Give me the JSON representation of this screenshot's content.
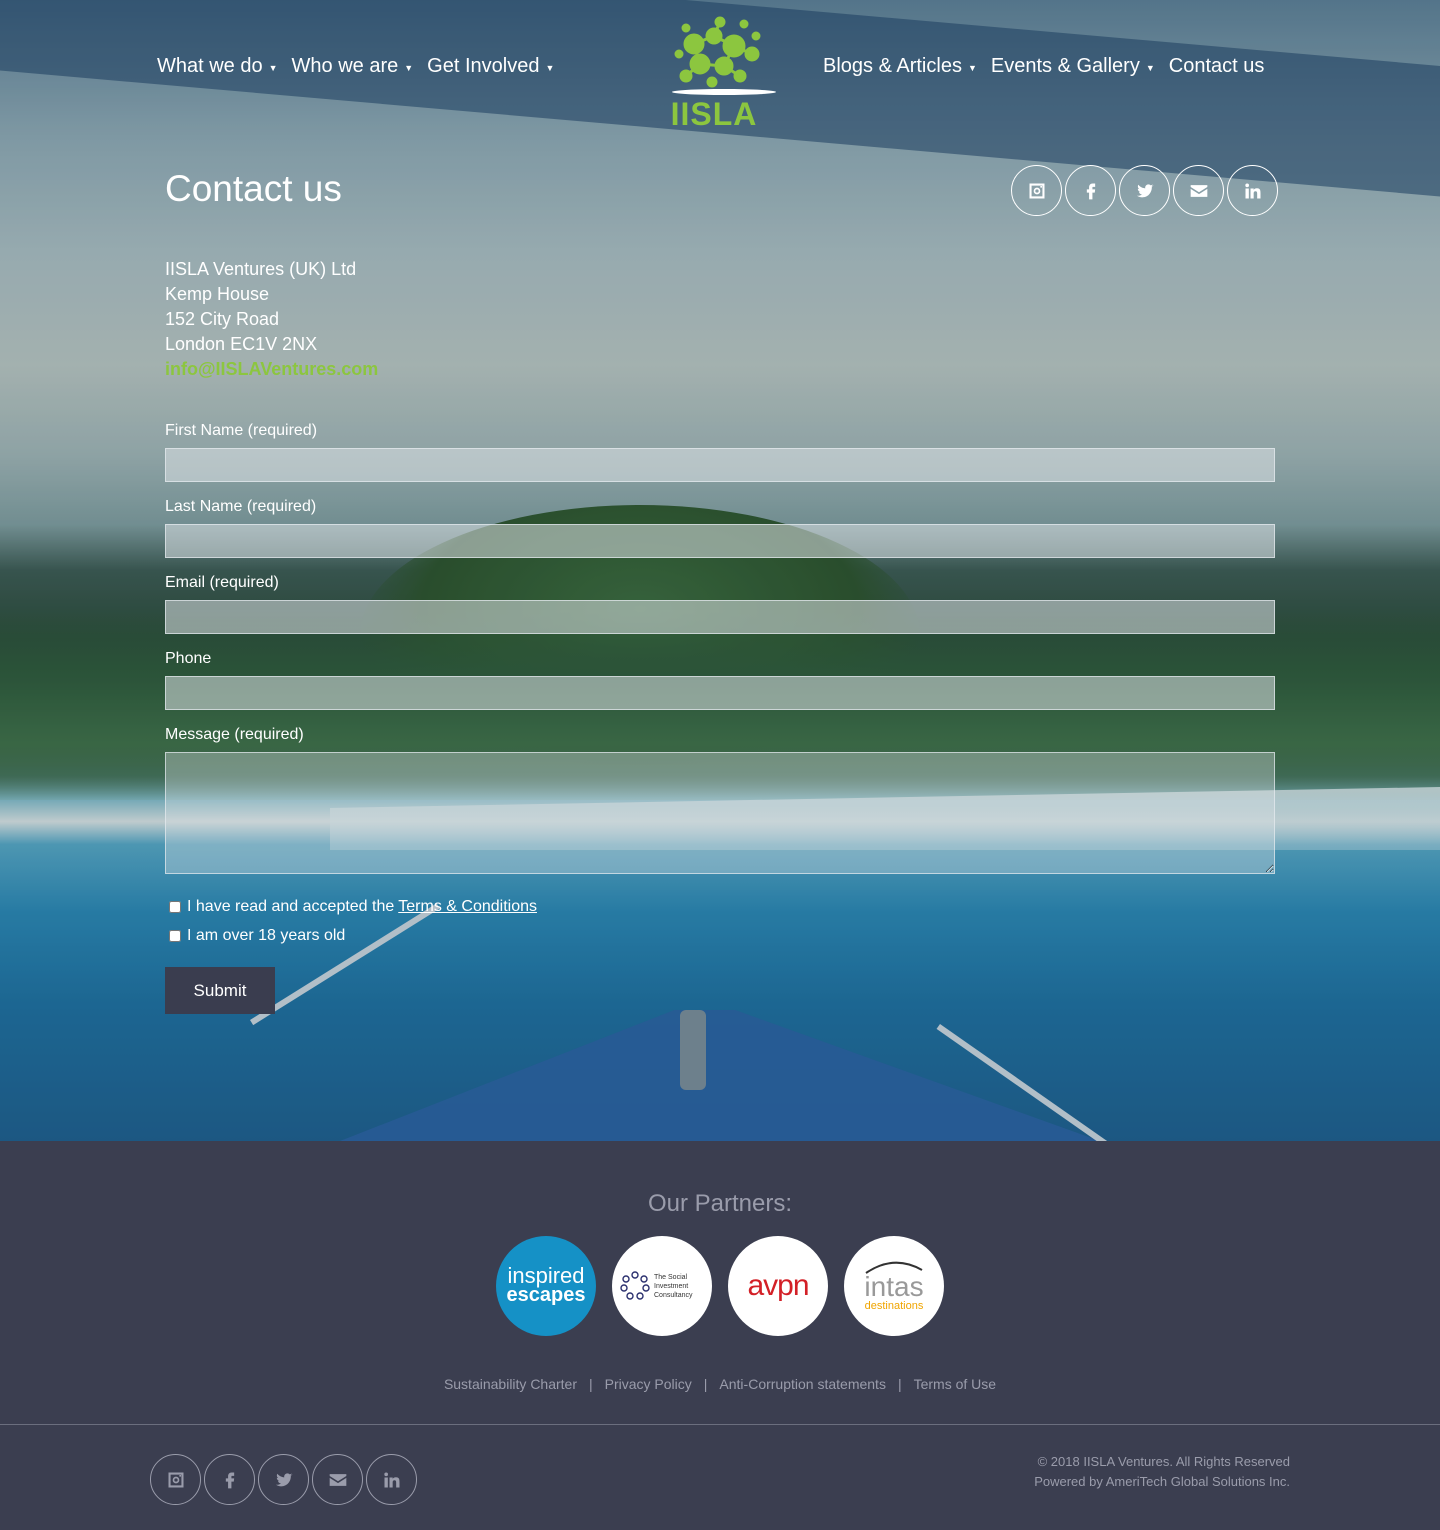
{
  "nav": {
    "left": [
      {
        "label": "What we do",
        "has_dropdown": true
      },
      {
        "label": "Who we are",
        "has_dropdown": true
      },
      {
        "label": "Get Involved",
        "has_dropdown": true
      }
    ],
    "right": [
      {
        "label": "Blogs & Articles",
        "has_dropdown": true
      },
      {
        "label": "Events & Gallery",
        "has_dropdown": true
      },
      {
        "label": "Contact us",
        "has_dropdown": false
      }
    ],
    "caret": "▼"
  },
  "logo": {
    "text": "IISLA",
    "color": "#8cc63f"
  },
  "page": {
    "title": "Contact us"
  },
  "social": [
    "instagram-icon",
    "facebook-icon",
    "twitter-icon",
    "envelope-icon",
    "linkedin-icon"
  ],
  "address": {
    "lines": [
      "IISLA Ventures (UK) Ltd",
      "Kemp House",
      "152 City Road",
      "London EC1V 2NX"
    ],
    "email": "info@IISLAVentures.com"
  },
  "form": {
    "first_name_label": "First Name (required)",
    "last_name_label": "Last Name (required)",
    "email_label": "Email (required)",
    "phone_label": "Phone",
    "message_label": "Message (required)",
    "terms_text": "I have read and accepted the",
    "terms_link": "Terms & Conditions",
    "age_text": "I am over 18 years old",
    "submit_label": "Submit"
  },
  "footer": {
    "partners_title": "Our Partners:",
    "partners": {
      "inspired_1": "inspired",
      "inspired_2": "escapes",
      "sic": "The Social Investment Consultancy",
      "avpn": "avpn",
      "intas_1": "intas",
      "intas_2": "destinations"
    },
    "links": [
      "Sustainability Charter",
      "Privacy Policy",
      "Anti-Corruption statements",
      "Terms of Use"
    ],
    "separator": "|",
    "copyright": "© 2018 IISLA Ventures. All Rights Reserved",
    "powered_by": "Powered by  AmeriTech Global Solutions Inc."
  },
  "colors": {
    "accent": "#8cc63f",
    "footer_bg": "#3b3e50",
    "submit_bg": "#3a3d4f"
  }
}
